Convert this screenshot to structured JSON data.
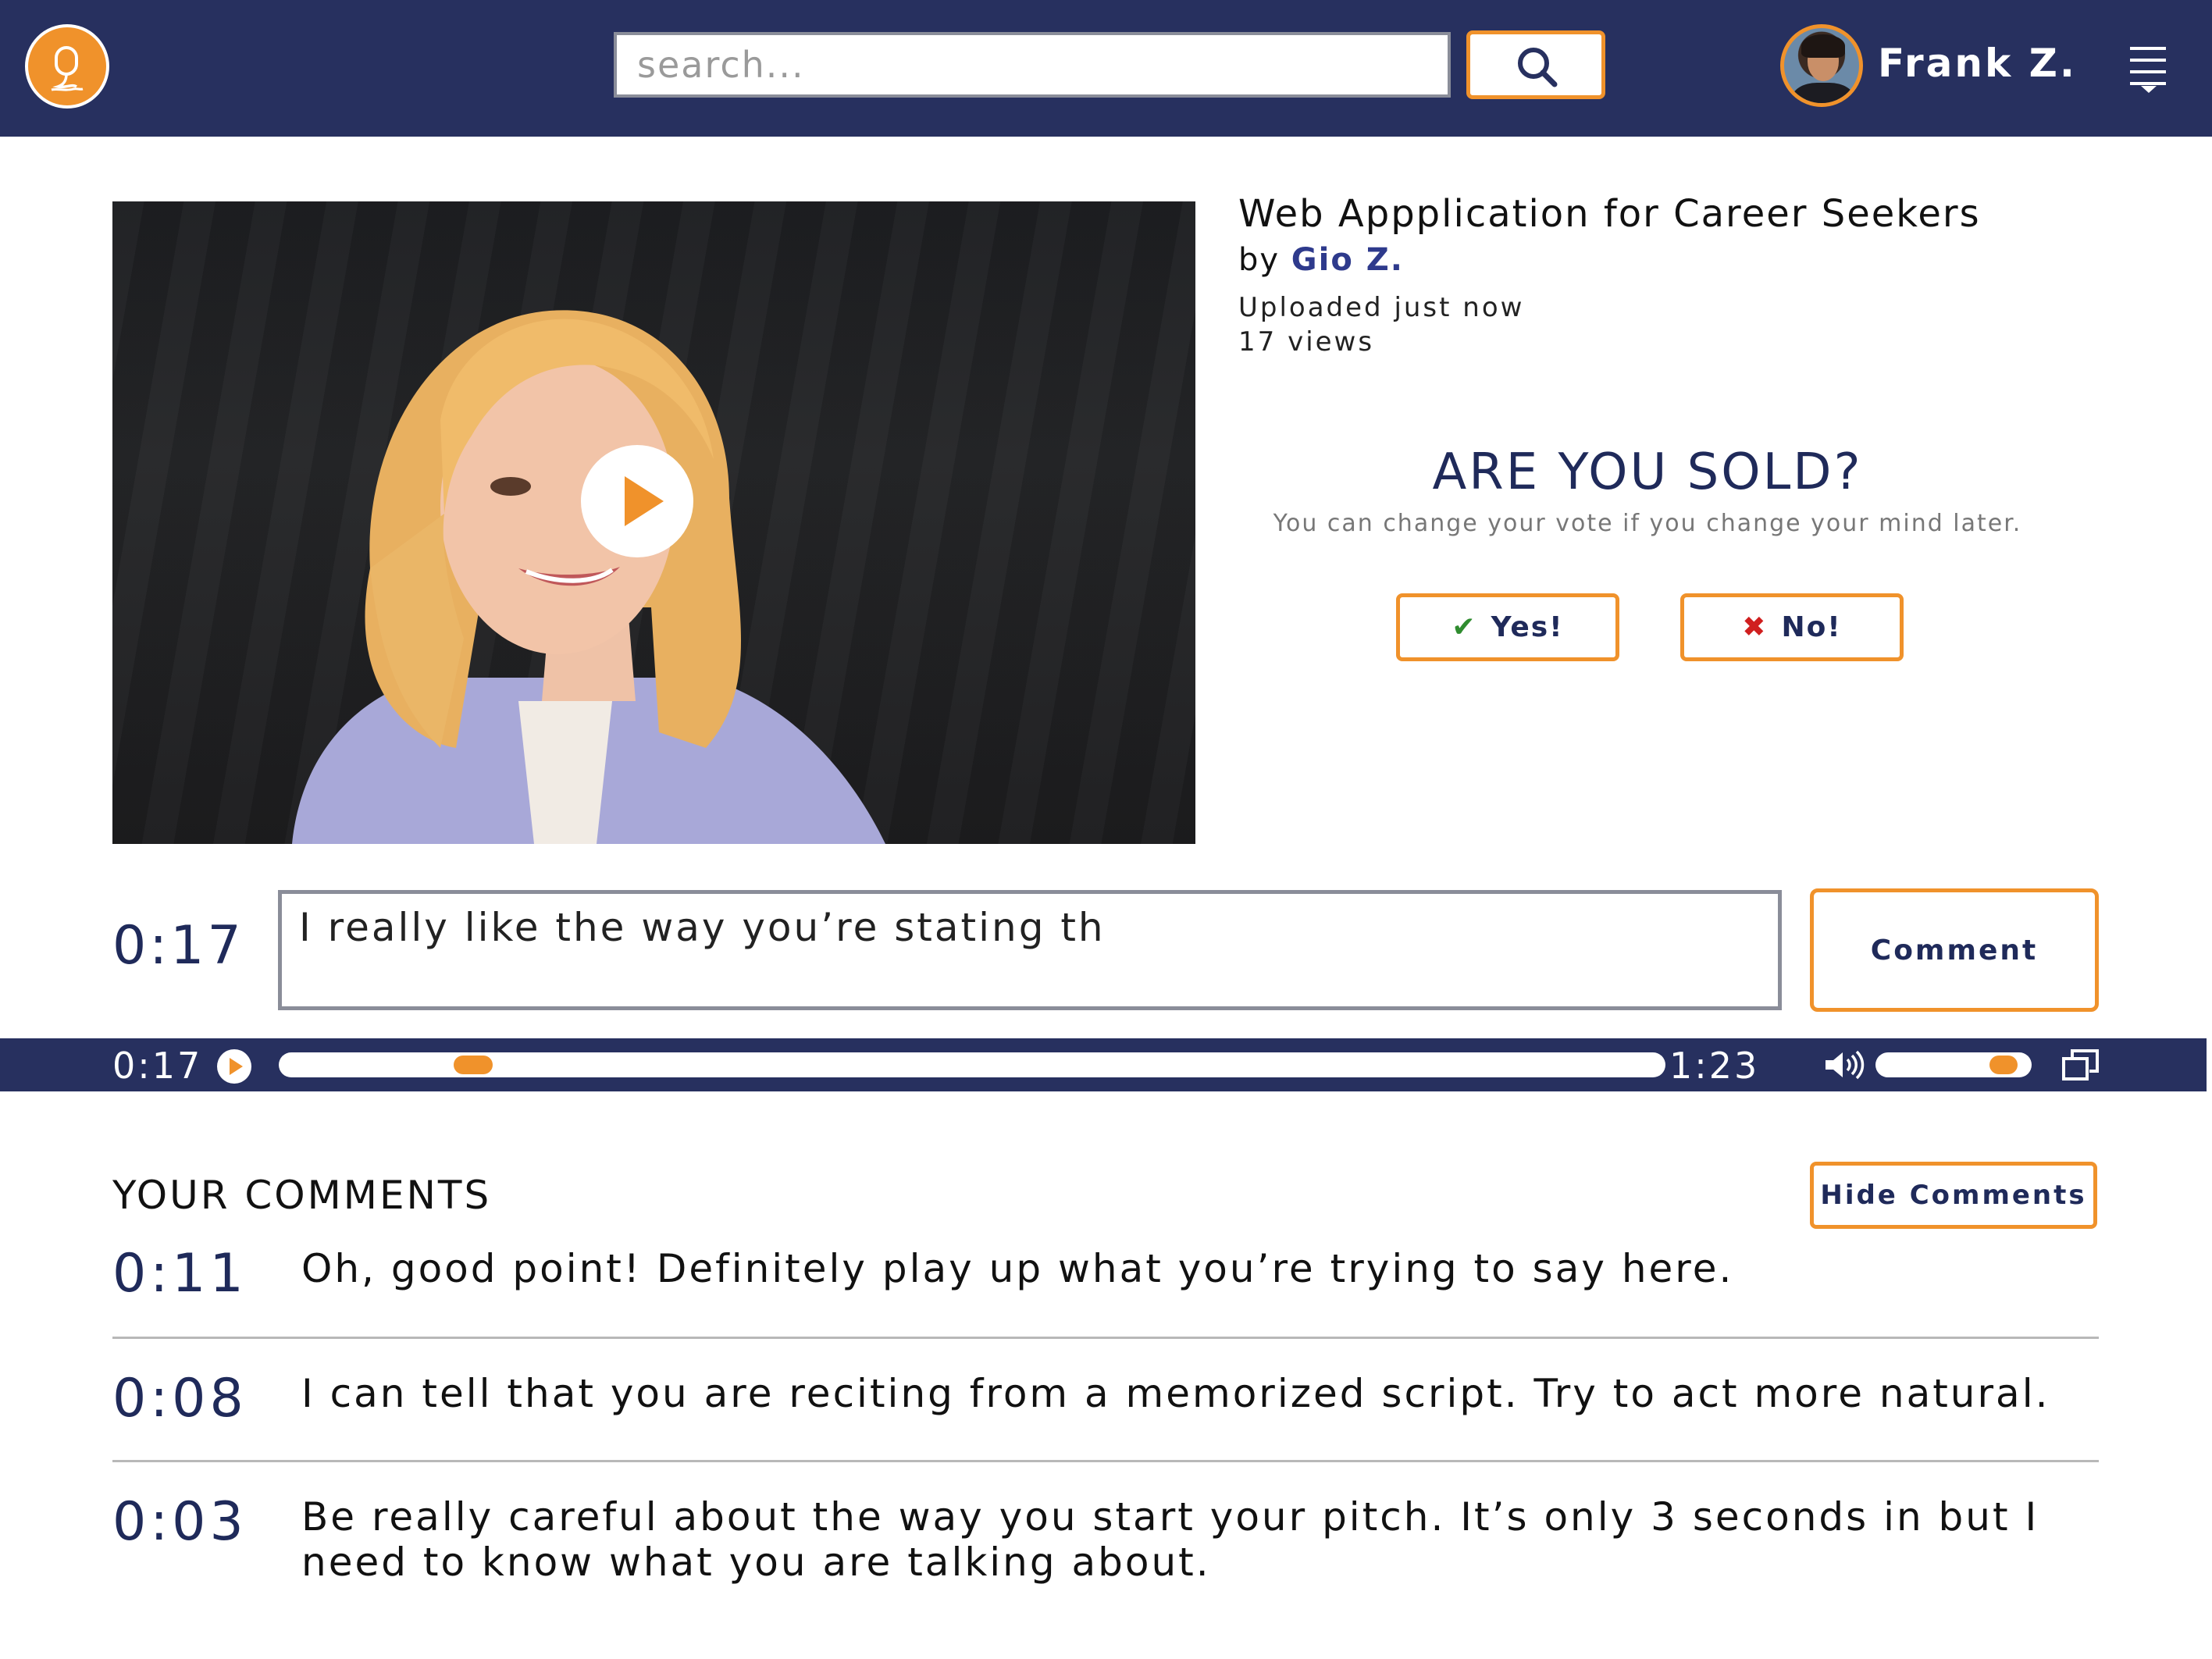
{
  "header": {
    "search_placeholder": "search...",
    "user_name": "Frank Z."
  },
  "video": {
    "title": "Web Appplication for Career Seekers",
    "by_label": "by",
    "author": "Gio Z.",
    "uploaded": "Uploaded just now",
    "views": "17 views"
  },
  "vote": {
    "heading": "ARE YOU SOLD?",
    "subtext": "You can change your vote if you change your mind later.",
    "yes_label": "Yes!",
    "no_label": "No!"
  },
  "comment_entry": {
    "time": "0:17",
    "value": "I really like the way you’re stating th",
    "button_label": "Comment"
  },
  "player": {
    "current_time": "0:17",
    "total_time": "1:23",
    "progress_fraction": 0.14,
    "volume_fraction": 0.82
  },
  "comments": {
    "heading": "YOUR COMMENTS",
    "hide_label": "Hide Comments",
    "items": [
      {
        "time": "0:11",
        "text": "Oh, good point! Definitely play up what you’re trying to say here."
      },
      {
        "time": "0:08",
        "text": "I can tell that you are reciting from a memorized script. Try to act more natural."
      },
      {
        "time": "0:03",
        "text": "Be really careful about the way you start your pitch. It’s only 3 seconds in but I need to know what you are talking about."
      }
    ]
  },
  "colors": {
    "navy": "#27305f",
    "accent": "#f0922b",
    "author_link": "#2e3a8c"
  },
  "icons": [
    "logo-icon",
    "search-icon",
    "menu-icon",
    "play-icon",
    "check-icon",
    "x-icon",
    "volume-icon",
    "fullscreen-icon"
  ]
}
